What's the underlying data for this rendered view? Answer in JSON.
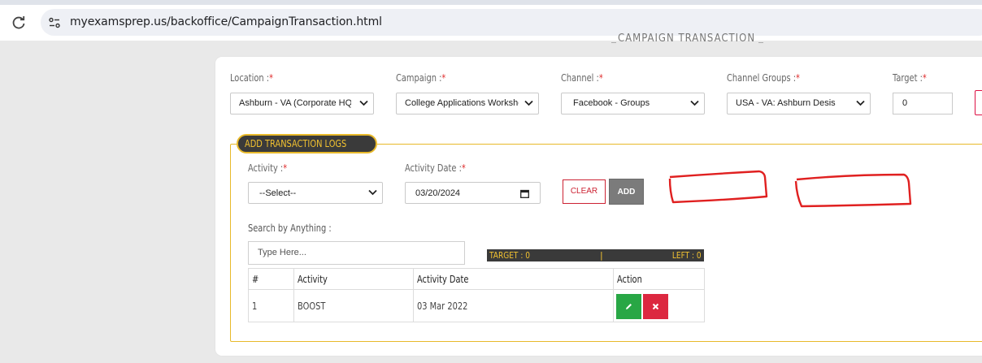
{
  "browser": {
    "url": "myexamsprep.us/backoffice/CampaignTransaction.html"
  },
  "page": {
    "heading": "CAMPAIGN TRANSACTION"
  },
  "filters": {
    "location": {
      "label": "Location :",
      "required_mark": "*",
      "value": "Ashburn - VA (Corporate HQ"
    },
    "campaign": {
      "label": "Campaign :",
      "required_mark": "*",
      "value": "College Applications Workshop"
    },
    "channel": {
      "label": "Channel :",
      "required_mark": "*",
      "value": "Facebook - Groups"
    },
    "channel_groups": {
      "label": "Channel Groups :",
      "required_mark": "*",
      "value": "USA - VA: Ashburn Desis"
    },
    "target": {
      "label": "Target :",
      "required_mark": "*",
      "value": "0"
    }
  },
  "transaction_logs": {
    "legend": "ADD TRANSACTION LOGS",
    "activity": {
      "label": "Activity :",
      "required_mark": "*",
      "value": "--Select--"
    },
    "activity_date": {
      "label": "Activity Date :",
      "required_mark": "*",
      "value": "03/20/2024"
    },
    "clear_label": "CLEAR",
    "add_label": "ADD",
    "search": {
      "label": "Search by Anything :",
      "placeholder": "Type Here..."
    },
    "target_bar": {
      "target": "TARGET : 0",
      "separator": "|",
      "left": "LEFT : 0"
    },
    "table": {
      "columns": [
        "#",
        "Activity",
        "Activity Date",
        "Action"
      ],
      "rows": [
        {
          "num": "1",
          "activity": "BOOST",
          "date": "03 Mar 2022"
        }
      ]
    }
  },
  "icons": {
    "reload": "reload-icon",
    "site_info": "site-info-icon",
    "edit": "pencil-icon",
    "delete": "x-icon",
    "dropdown": "chevron-down-icon",
    "calendar": "calendar-icon"
  },
  "colors": {
    "accent_yellow": "#e8b92a",
    "dark_bar": "#3a3a3a",
    "edit_green": "#28a745",
    "delete_red": "#dc2840",
    "annotation_red": "#e02020"
  }
}
